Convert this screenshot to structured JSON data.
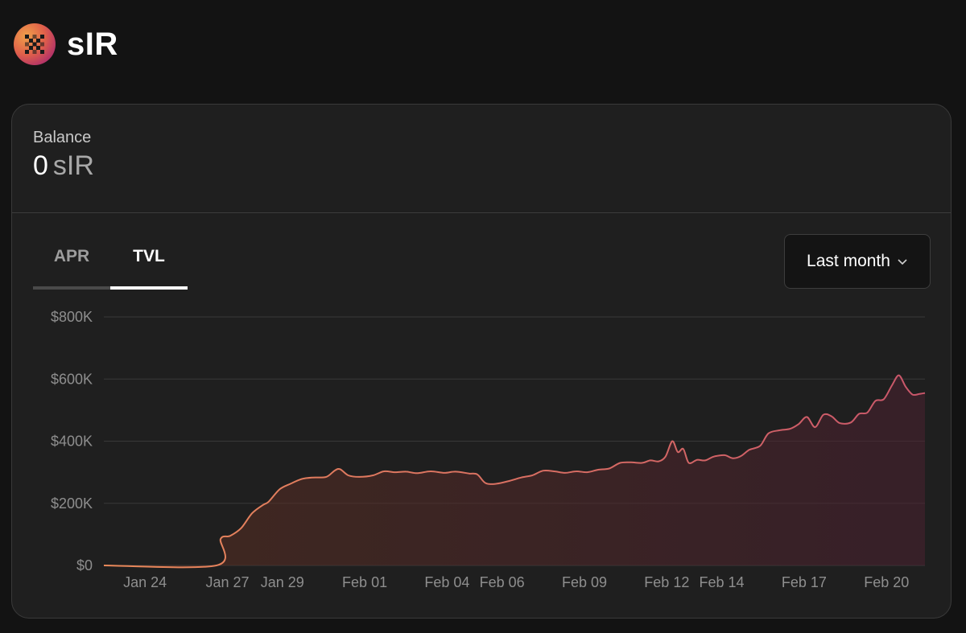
{
  "header": {
    "token_name": "sIR",
    "logo_icon": "checker-x-logo-icon"
  },
  "balance": {
    "label": "Balance",
    "amount": "0",
    "symbol": "sIR"
  },
  "tabs": [
    {
      "label": "APR",
      "active": false
    },
    {
      "label": "TVL",
      "active": true
    }
  ],
  "period": {
    "selected": "Last month",
    "icon": "chevron-down-icon"
  },
  "colors": {
    "line_start": "#e9895a",
    "line_end": "#c9566a",
    "background": "#131313",
    "card": "#1f1f1f"
  },
  "chart_data": {
    "type": "area",
    "title": "",
    "xlabel": "",
    "ylabel": "",
    "ylim": [
      0,
      800000
    ],
    "y_ticks": [
      0,
      200000,
      400000,
      600000,
      800000
    ],
    "y_tick_labels": [
      "$0",
      "$200K",
      "$400K",
      "$600K",
      "$800K"
    ],
    "x_ticks": [
      {
        "t": 1.5,
        "label": "Jan 24"
      },
      {
        "t": 4.5,
        "label": "Jan 27"
      },
      {
        "t": 6.5,
        "label": "Jan 29"
      },
      {
        "t": 9.5,
        "label": "Feb 01"
      },
      {
        "t": 12.5,
        "label": "Feb 04"
      },
      {
        "t": 14.5,
        "label": "Feb 06"
      },
      {
        "t": 17.5,
        "label": "Feb 09"
      },
      {
        "t": 20.5,
        "label": "Feb 12"
      },
      {
        "t": 22.5,
        "label": "Feb 14"
      },
      {
        "t": 25.5,
        "label": "Feb 17"
      },
      {
        "t": 28.5,
        "label": "Feb 20"
      }
    ],
    "grid": true,
    "legend": "none",
    "series": [
      {
        "points": [
          [
            -0.2,
            0
          ],
          [
            4.1,
            0
          ],
          [
            4.25,
            85000
          ],
          [
            4.6,
            95000
          ],
          [
            5.0,
            120000
          ],
          [
            5.4,
            168000
          ],
          [
            5.8,
            195000
          ],
          [
            6.0,
            205000
          ],
          [
            6.4,
            245000
          ],
          [
            6.8,
            263000
          ],
          [
            7.2,
            278000
          ],
          [
            7.6,
            283000
          ],
          [
            8.1,
            285000
          ],
          [
            8.4,
            305000
          ],
          [
            8.6,
            310000
          ],
          [
            8.9,
            290000
          ],
          [
            9.3,
            285000
          ],
          [
            9.8,
            290000
          ],
          [
            10.2,
            303000
          ],
          [
            10.6,
            300000
          ],
          [
            11.0,
            302000
          ],
          [
            11.4,
            297000
          ],
          [
            11.9,
            303000
          ],
          [
            12.4,
            298000
          ],
          [
            12.8,
            302000
          ],
          [
            13.3,
            296000
          ],
          [
            13.6,
            293000
          ],
          [
            13.9,
            265000
          ],
          [
            14.3,
            263000
          ],
          [
            14.8,
            273000
          ],
          [
            15.2,
            283000
          ],
          [
            15.6,
            290000
          ],
          [
            16.0,
            305000
          ],
          [
            16.4,
            303000
          ],
          [
            16.8,
            298000
          ],
          [
            17.2,
            303000
          ],
          [
            17.6,
            300000
          ],
          [
            18.0,
            308000
          ],
          [
            18.4,
            312000
          ],
          [
            18.8,
            330000
          ],
          [
            19.2,
            332000
          ],
          [
            19.6,
            330000
          ],
          [
            19.9,
            338000
          ],
          [
            20.2,
            335000
          ],
          [
            20.45,
            350000
          ],
          [
            20.7,
            400000
          ],
          [
            20.9,
            365000
          ],
          [
            21.1,
            375000
          ],
          [
            21.3,
            330000
          ],
          [
            21.6,
            340000
          ],
          [
            21.9,
            338000
          ],
          [
            22.2,
            350000
          ],
          [
            22.6,
            355000
          ],
          [
            22.9,
            345000
          ],
          [
            23.2,
            352000
          ],
          [
            23.5,
            372000
          ],
          [
            23.9,
            385000
          ],
          [
            24.2,
            425000
          ],
          [
            24.6,
            435000
          ],
          [
            25.0,
            440000
          ],
          [
            25.3,
            455000
          ],
          [
            25.6,
            478000
          ],
          [
            25.9,
            445000
          ],
          [
            26.2,
            485000
          ],
          [
            26.5,
            480000
          ],
          [
            26.8,
            458000
          ],
          [
            27.2,
            460000
          ],
          [
            27.5,
            488000
          ],
          [
            27.8,
            492000
          ],
          [
            28.1,
            530000
          ],
          [
            28.4,
            535000
          ],
          [
            28.7,
            580000
          ],
          [
            28.95,
            612000
          ],
          [
            29.2,
            575000
          ],
          [
            29.45,
            550000
          ],
          [
            29.7,
            552000
          ],
          [
            29.9,
            555000
          ]
        ]
      }
    ]
  }
}
